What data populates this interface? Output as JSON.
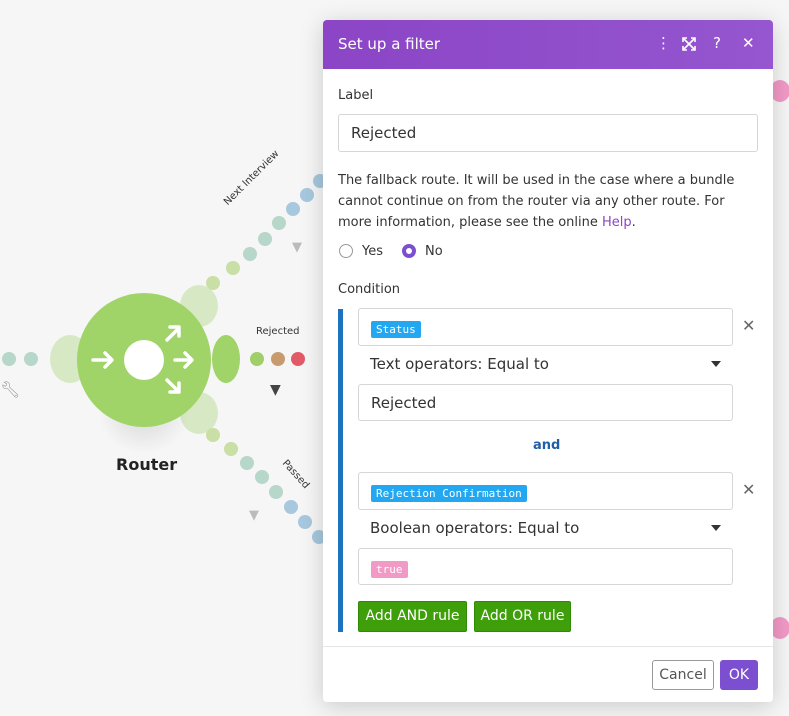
{
  "canvas": {
    "router_label": "Router",
    "routes": [
      {
        "label": "Next Interview"
      },
      {
        "label": "Rejected"
      },
      {
        "label": "Passed"
      }
    ]
  },
  "dialog": {
    "title": "Set up a filter",
    "label_heading": "Label",
    "label_value": "Rejected",
    "fallback_text": "The fallback route. It will be used in the case where a bundle cannot continue on from the router via any other route. For more information, please see the online ",
    "help_link": "Help",
    "fallback_period": ".",
    "radio_yes": "Yes",
    "radio_no": "No",
    "condition_heading": "Condition",
    "rule1": {
      "field_tag": "Status",
      "operator": "Text operators: Equal to",
      "value": "Rejected"
    },
    "and_label": "and",
    "rule2": {
      "field_tag": "Rejection Confirmation",
      "operator": "Boolean operators: Equal to",
      "value_tag": "true"
    },
    "add_and_rule": "Add AND rule",
    "add_or_rule": "Add OR rule",
    "cancel": "Cancel",
    "ok": "OK"
  },
  "colors": {
    "header_purple": "#8b45c6",
    "router_green": "#a0d468",
    "condition_blue": "#1e73be",
    "tag_blue": "#22a7f0",
    "tag_pink": "#f29ac6",
    "button_green": "#3f9f0a",
    "ok_purple": "#7b4fd0"
  }
}
